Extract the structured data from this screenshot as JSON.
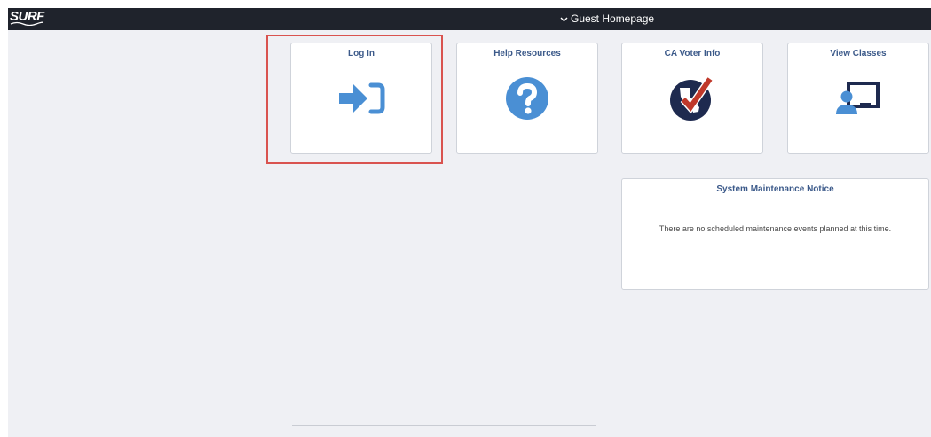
{
  "header": {
    "logo_text": "SURF",
    "title": "Guest Homepage",
    "title_icon": "chevron-down-icon"
  },
  "tiles": [
    {
      "title": "Log In",
      "icon": "sign-in-icon",
      "highlighted": true
    },
    {
      "title": "Help Resources",
      "icon": "question-circle-icon"
    },
    {
      "title": "CA Voter Info",
      "icon": "california-check-icon"
    },
    {
      "title": "View Classes",
      "icon": "presentation-user-icon"
    }
  ],
  "notice": {
    "title": "System Maintenance Notice",
    "text": "There are no scheduled maintenance events planned at this time."
  },
  "colors": {
    "header_bg": "#1f232c",
    "page_bg": "#eff0f4",
    "tile_title": "#3c5a8a",
    "icon_blue": "#4a8fd4",
    "navy": "#1e2a4f",
    "check_red": "#c0392b",
    "highlight": "#d9534f"
  }
}
